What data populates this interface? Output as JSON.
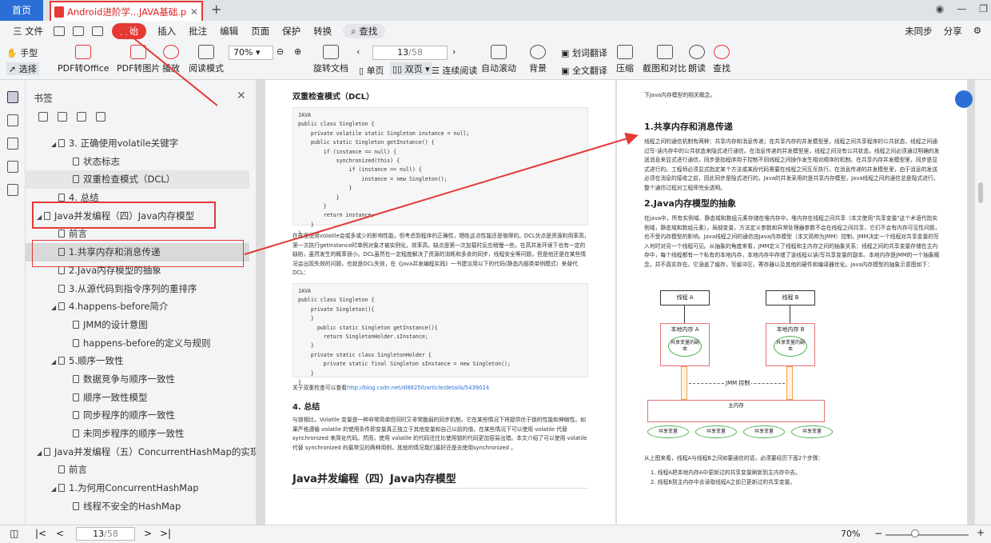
{
  "tabs": {
    "home": "首页",
    "doc": "Android进阶学...JAVA基础.pdf",
    "new": "+"
  },
  "menu": {
    "items": [
      "三 文件",
      "开始",
      "插入",
      "批注",
      "编辑",
      "页面",
      "保护",
      "转换"
    ],
    "search": "查找",
    "right": [
      "未同步",
      "分享"
    ]
  },
  "toolbar": {
    "hand": "手型",
    "select": "选择",
    "pdf_office": "PDF转Office",
    "pdf_image": "PDF转图片",
    "play": "播放",
    "read": "阅读模式",
    "zoom": "70%",
    "rotate": "旋转文档",
    "single": "单页",
    "double": "双页",
    "continuous": "连续阅读",
    "auto_scroll": "自动滚动",
    "background": "背景",
    "word_translate": "划词翻译",
    "full_translate": "全文翻译",
    "compress": "压缩",
    "screenshot": "截图和对比",
    "read_aloud": "朗读",
    "find": "查找",
    "page_current": "13",
    "page_total": "/58"
  },
  "sidebar": {
    "title": "书签",
    "items": [
      {
        "label": "3. 正确使用volatile关键字",
        "level": 1,
        "expanded": true
      },
      {
        "label": "状态标志",
        "level": 2
      },
      {
        "label": "双重检查模式（DCL）",
        "level": 2,
        "selected": true
      },
      {
        "label": "4. 总结",
        "level": 1
      },
      {
        "label": "Java并发编程（四）Java内存模型",
        "level": 0,
        "expanded": true
      },
      {
        "label": "前言",
        "level": 1
      },
      {
        "label": "1.共享内存和消息传递",
        "level": 1,
        "selected": true
      },
      {
        "label": "2.Java内存模型的抽象",
        "level": 1
      },
      {
        "label": "3.从源代码到指令序列的重排序",
        "level": 1
      },
      {
        "label": "4.happens-before简介",
        "level": 1,
        "expanded": true
      },
      {
        "label": "JMM的设计意图",
        "level": 2
      },
      {
        "label": "happens-before的定义与规则",
        "level": 2
      },
      {
        "label": "5.顺序一致性",
        "level": 1,
        "expanded": true
      },
      {
        "label": "数据竞争与顺序一致性",
        "level": 2
      },
      {
        "label": "顺序一致性模型",
        "level": 2
      },
      {
        "label": "同步程序的顺序一致性",
        "level": 2
      },
      {
        "label": "未同步程序的顺序一致性",
        "level": 2
      },
      {
        "label": "Java并发编程（五）ConcurrentHashMap的实现原理和源码分析",
        "level": 0,
        "expanded": true
      },
      {
        "label": "前言",
        "level": 1
      },
      {
        "label": "1.为何用ConcurrentHashMap",
        "level": 1,
        "expanded": true
      },
      {
        "label": "线程不安全的HashMap",
        "level": 2
      }
    ]
  },
  "left_page": {
    "heading1": "双重检查模式（DCL）",
    "code1": "JAVA\npublic class Singleton {\n    private volatile static Singleton instance = null;\n    public static Singleton getInstance() {\n        if (instance == null) {\n            synchronized(this) {\n                if (instance == null) {\n                    instance = new Singleton();\n                }\n            }\n        }\n        return instance;\n    }\n}",
    "para1": "在这里使用volatile会或多或少的影响性能，但考虑到程序的正确性，牺牲这点性能还是值得的。DCL优点是资源利用率高，第一次执行getInstance时单例对象才被实例化，效率高。缺点是第一次加载时反应稍慢一些，在高并发环境下也有一定的缺陷，虽然发生的概率很小。DCL虽然在一定程度解决了资源的消耗和多余的同步，线程安全等问题，但是他还是在某些情况会出现失效的问题，也就是DCL失效，在《java并发编程实践》一书建议用以下的代码(静态内部类单例模式）来替代DCL：",
    "code2": "JAVA\npublic class Singleton {\n    private Singleton(){\n    }\n      public static Singleton getInstance(){\n        return SingletonHolder.sInstance;\n    }\n    private static class SingletonHolder {\n        private static final Singleton sInstance = new Singleton();\n    }\n}",
    "link_prefix": "关于双重检查可以查看",
    "link": "http://blog.csdn.net/dl88250/article/details/5439024",
    "heading2": "4. 总结",
    "para2": "与锁相比，Volatile 变量是一种非常简单但同时又非常脆弱的同步机制，它在某些情况下将提供优于锁的性能和伸缩性。如果严格遵循 volatile 的使用条件即变量真正独立于其他变量和自己以前的值，在某些情况下可以使用 volatile 代替 synchronized 来简化代码。然而，使用 volatile 的代码往往比使用锁的代码更加容易出错。本文介绍了可以使用 volatile 代替 synchronized 的最常见的两种用例，其他的情况我们最好还是去使用synchronized 。",
    "heading3": "Java并发编程（四）Java内存模型"
  },
  "right_page": {
    "intro": "下Java内存模型的相关概念。",
    "heading1": "1.共享内存和消息传递",
    "para1": "线程之间的通信机制有两种：共享内存和消息传递；在共享内存的并发模型里，线程之间共享程序的公共状态，线程之间通过写-读内存中的公共状态来隐式进行通信。在消息传递的并发模型里，线程之间没有公共状态，线程之间必须通过明确的发送消息来显式进行通信。同步是指程序用于控制不同线程之间操作发生相对顺序的机制。在共享内存并发模型里，同步是显式进行的。工程师必须显式指定某个方法或某段代码需要在线程之间互斥执行。在消息传递的并发模型里，由于消息的发送必须在消息的接收之前，因此同步是隐式进行的。Java的并发采用的是共享内存模型，Java线程之间的通信总是隐式进行，整个通信过程对工程师完全透明。",
    "heading2": "2.Java内存模型的抽象",
    "para2": "在java中，所有实例域、静态域和数组元素存储在堆内存中，堆内存在线程之间共享（本文使用\"共享变量\"这个术语代指实例域，静态域和数组元素）。局部变量，方法定义参数和异常处理器参数不会在线程之间共享，它们不会有内存可见性问题，也不受内存模型的影响。Java线程之间的通信由Java内存模型（本文简称为JMM）控制，JMM决定一个线程对共享变量的写入何时对另一个线程可见。从抽象的角度来看，JMM定义了线程和主内存之间的抽象关系：线程之间的共享变量存储在主内存中，每个线程都有一个私有的本地内存，本地内存中存储了该线程以读/写共享变量的副本。本地内存是JMM的一个抽象概念，并不真实存在。它涵盖了缓存，写缓冲区，寄存器以及其他的硬件和编译器优化。Java内存模型的抽象示意图如下：",
    "diagram": {
      "thread_a": "线程 A",
      "thread_b": "线程 B",
      "local_a": "本地内存 A",
      "local_b": "本地内存 B",
      "copy": "共享变量的副本",
      "jmm": "JMM 控制",
      "main": "主内存",
      "shared": "共享变量"
    },
    "para3": "从上图来看，线程A与线程B之间如要通信的话，必须要经历下面2个步骤：",
    "step1": "1. 线程A把本地内存A中更新过的共享变量刷新到主内存中去。",
    "step2": "2. 线程B到主内存中去读取线程A之前已更新过的共享变量。"
  },
  "status": {
    "page_current": "13",
    "page_total": "/58",
    "zoom": "70%"
  }
}
